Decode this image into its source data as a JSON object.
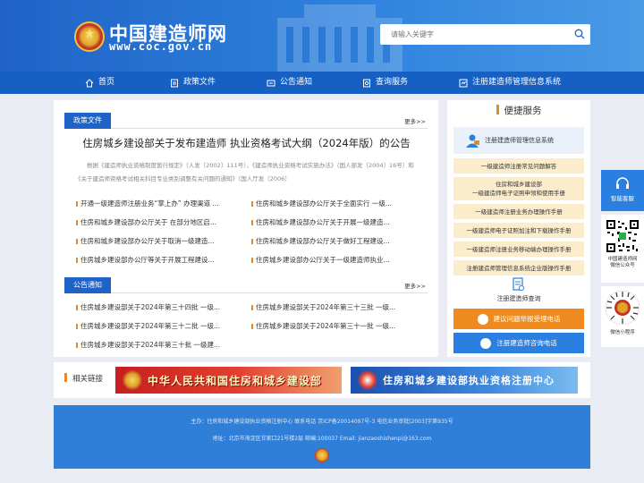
{
  "header": {
    "site_name": "中国建造师网",
    "site_url": "www.coc.gov.cn",
    "search_placeholder": "请输入关键字"
  },
  "nav": {
    "items": [
      {
        "label": "首页",
        "icon": "home-icon"
      },
      {
        "label": "政策文件",
        "icon": "document-icon"
      },
      {
        "label": "公告通知",
        "icon": "announcement-icon"
      },
      {
        "label": "查询服务",
        "icon": "query-icon"
      },
      {
        "label": "注册建造师管理信息系统",
        "icon": "system-icon"
      }
    ]
  },
  "policy": {
    "tab": "政策文件",
    "more": "更多>>",
    "headline": "住房城乡建设部关于发布建造师 执业资格考试大纲（2024年版）的公告",
    "summary": "根据《建造师执业资格制度暂行规定》（人发〔2002〕111号）、《建造师执业资格考试实施办法》（国人部发〔2004〕16号）和《关于建造师资格考试相关科目专业类别调整有关问题的通知》（国人厅发〔2006〕",
    "items": [
      "开通一级建造师注册业务“掌上办” 办理渠道 ...",
      "住房和城乡建设部办公厅关于全面实行 一级...",
      "住房和城乡建设部办公厅关于 在部分地区启...",
      "住房和城乡建设部办公厅关于开展一级建造...",
      "住房和城乡建设部办公厅关于取消一级建造...",
      "住房和城乡建设部办公厅关于做好工程建设...",
      "住房城乡建设部办公厅等关于开展工程建设...",
      "住房城乡建设部办公厅关于一级建造师执业..."
    ]
  },
  "notice": {
    "tab": "公告通知",
    "more": "更多>>",
    "items": [
      "住房城乡建设部关于2024年第三十四批 一级...",
      "住房城乡建设部关于2024年第三十三批 一级...",
      "住房城乡建设部关于2024年第三十二批 一级...",
      "住房城乡建设部关于2024年第三十一批 一级...",
      "住房城乡建设部关于2024年第三十批 一级建..."
    ]
  },
  "sidebar": {
    "title": "便捷服务",
    "reg_system": "注册建造师管理信息系统",
    "links": [
      "一级建造师注册常见问题解答",
      "住房和城乡建设部\n一级建造师电子证照申领和使用手册",
      "一级建造师注册业务办理操作手册",
      "一级建造师电子证照加注和下载操作手册",
      "一级建造师注册业务移动端办理操作手册",
      "注册建造师管理信息系统企业版操作手册"
    ],
    "query": "注册建造师查询",
    "btn_complaint": "建议问题举报受理电话",
    "btn_consult": "注册建造师咨询电话"
  },
  "related": {
    "title": "相关链接",
    "banner1": "中华人民共和国住房和城乡建设部",
    "banner2": "住房和城乡建设部执业资格注册中心"
  },
  "footer": {
    "line1": "主办：住房和城乡建设部执业资格注册中心 联系电话 京ICP备20014097号-3 电信业务审批[2003]字第935号",
    "line2": "地址：北京市海淀区甘家口21号楼2层  邮编:100037  Email: jianzaoshishenpi@163.com"
  },
  "float": {
    "service": "智能客服",
    "qr1_label": "中国建造师网\n微信公众号",
    "qr2_label": "微信小程序"
  },
  "colors": {
    "primary": "#1f63c6",
    "accent": "#e08a2a",
    "orange_button": "#ef8a1e",
    "blue_button": "#2a7fe0"
  }
}
